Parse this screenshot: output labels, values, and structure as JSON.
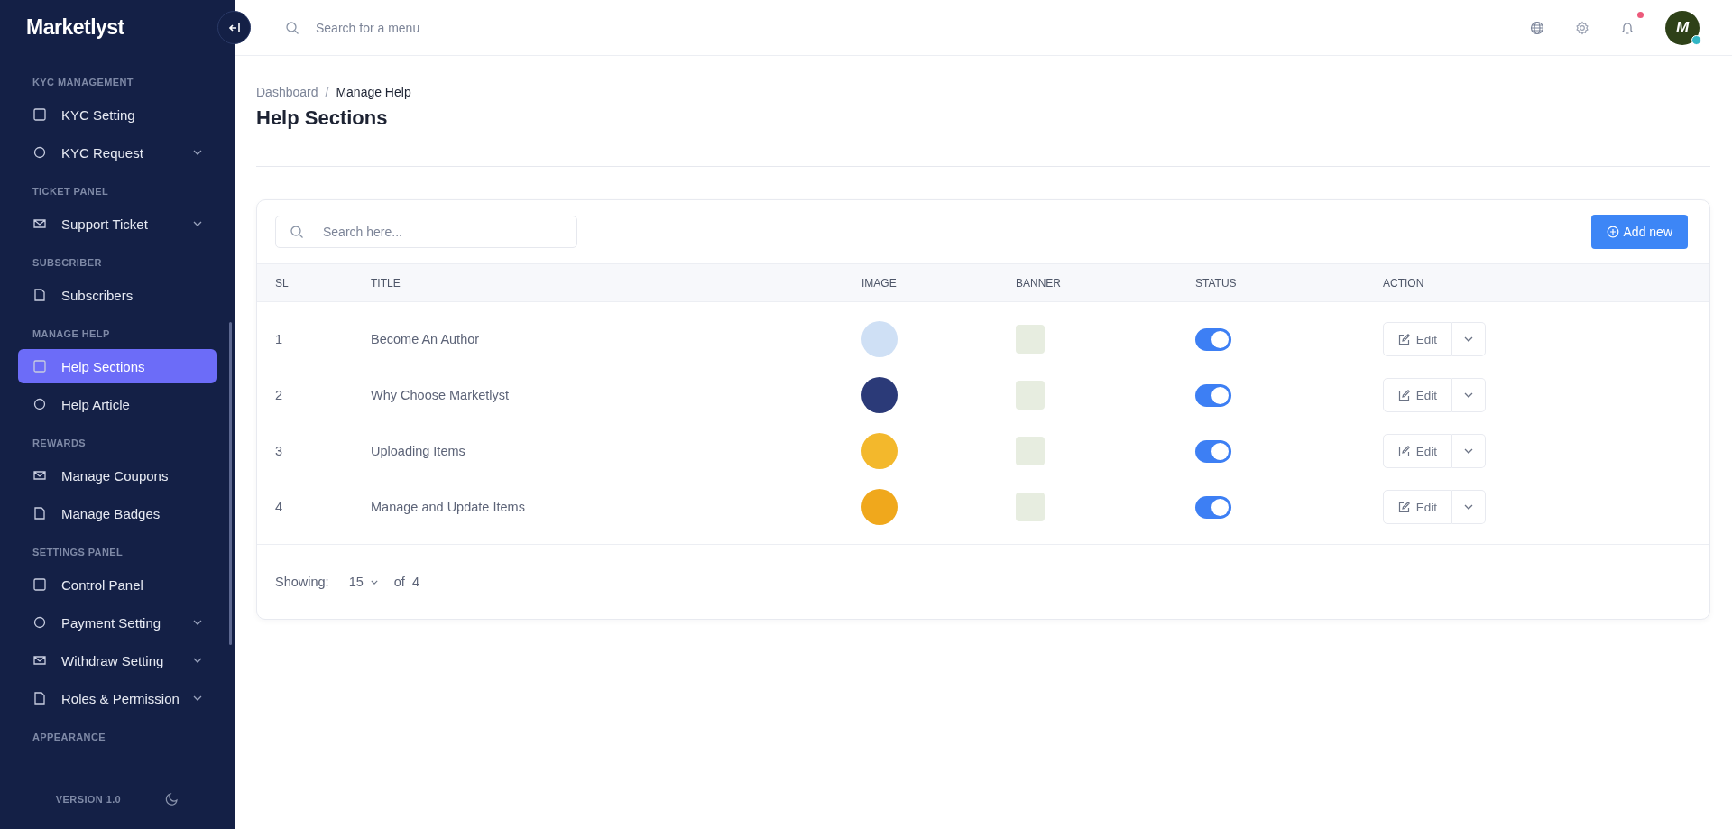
{
  "brand": "Marketlyst",
  "sidebar": {
    "sections": [
      {
        "label": "KYC MANAGEMENT",
        "items": [
          {
            "label": "KYC Setting",
            "expandable": false,
            "selected": false
          },
          {
            "label": "KYC Request",
            "expandable": true,
            "selected": false
          }
        ]
      },
      {
        "label": "TICKET PANEL",
        "items": [
          {
            "label": "Support Ticket",
            "expandable": true,
            "selected": false
          }
        ]
      },
      {
        "label": "SUBSCRIBER",
        "items": [
          {
            "label": "Subscribers",
            "expandable": false,
            "selected": false
          }
        ]
      },
      {
        "label": "MANAGE HELP",
        "items": [
          {
            "label": "Help Sections",
            "expandable": false,
            "selected": true
          },
          {
            "label": "Help Article",
            "expandable": false,
            "selected": false
          }
        ]
      },
      {
        "label": "REWARDS",
        "items": [
          {
            "label": "Manage Coupons",
            "expandable": false,
            "selected": false
          },
          {
            "label": "Manage Badges",
            "expandable": false,
            "selected": false
          }
        ]
      },
      {
        "label": "SETTINGS PANEL",
        "items": [
          {
            "label": "Control Panel",
            "expandable": false,
            "selected": false
          },
          {
            "label": "Payment Setting",
            "expandable": true,
            "selected": false
          },
          {
            "label": "Withdraw Setting",
            "expandable": true,
            "selected": false
          },
          {
            "label": "Roles & Permission",
            "expandable": true,
            "selected": false
          }
        ]
      },
      {
        "label": "APPEARANCE"
      }
    ],
    "version": "VERSION 1.0"
  },
  "topbar": {
    "search_placeholder": "Search for a menu",
    "avatar_letter": "M"
  },
  "breadcrumb": [
    "Dashboard",
    "Manage Help"
  ],
  "breadcrumb_separator": "/",
  "page_title": "Help Sections",
  "table": {
    "search_placeholder": "Search here...",
    "add_button": "Add new",
    "columns": [
      "SL",
      "TITLE",
      "IMAGE",
      "BANNER",
      "STATUS",
      "ACTION"
    ],
    "rows": [
      {
        "sl": "1",
        "title": "Become An Author",
        "status_on": true,
        "edit": "Edit"
      },
      {
        "sl": "2",
        "title": "Why Choose Marketlyst",
        "status_on": true,
        "edit": "Edit"
      },
      {
        "sl": "3",
        "title": "Uploading Items",
        "status_on": true,
        "edit": "Edit"
      },
      {
        "sl": "4",
        "title": "Manage and Update Items",
        "status_on": true,
        "edit": "Edit"
      }
    ]
  },
  "pagination": {
    "label": "Showing:",
    "per_page": "15",
    "of": "of",
    "total": "4"
  }
}
